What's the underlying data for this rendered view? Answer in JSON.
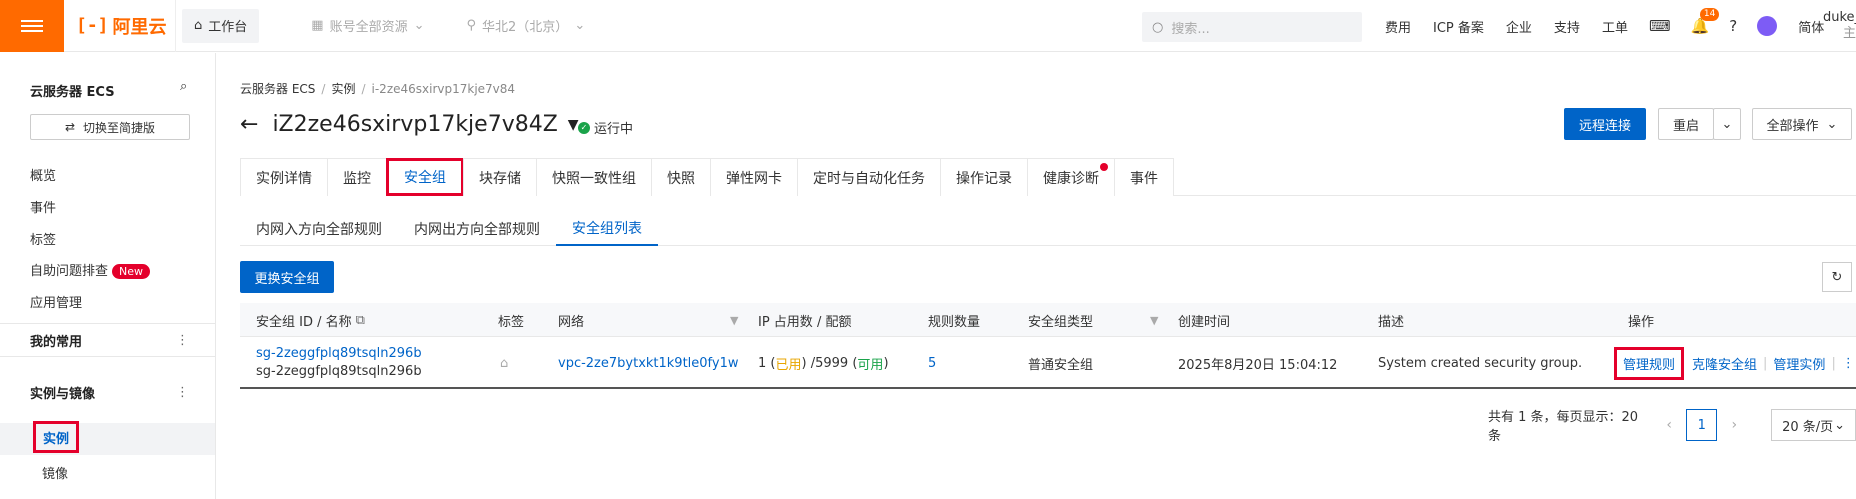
{
  "topbar": {
    "logo": "阿里云",
    "workbench": "工作台",
    "resources": "账号全部资源",
    "region": "华北2（北京）",
    "search_placeholder": "搜索...",
    "links": [
      "费用",
      "ICP 备案",
      "企业",
      "支持",
      "工单"
    ],
    "notification_count": "14",
    "language": "简体",
    "user_name": "duke_",
    "user_sub": "主"
  },
  "sidebar": {
    "title": "云服务器 ECS",
    "switch_label": "切换至简捷版",
    "items": [
      "概览",
      "事件",
      "标签",
      "自助问题排查",
      "应用管理"
    ],
    "new_badge": "New",
    "section_common": "我的常用",
    "section_instances": "实例与镜像",
    "more": "⋮",
    "sub_items": [
      "实例",
      "镜像"
    ]
  },
  "breadcrumb": {
    "items": [
      "云服务器 ECS",
      "实例"
    ],
    "current": "i-2ze46sxirvp17kje7v84",
    "sep": "/"
  },
  "header": {
    "title": "iZ2ze46sxirvp17kje7v84Z",
    "status": "运行中",
    "remote": "远程连接",
    "restart": "重启",
    "all_ops": "全部操作"
  },
  "tabs": [
    "实例详情",
    "监控",
    "安全组",
    "块存储",
    "快照一致性组",
    "快照",
    "弹性网卡",
    "定时与自动化任务",
    "操作记录",
    "健康诊断",
    "事件"
  ],
  "subtabs": [
    "内网入方向全部规则",
    "内网出方向全部规则",
    "安全组列表"
  ],
  "toolbar": {
    "change_sg": "更换安全组"
  },
  "table": {
    "headers": [
      "安全组 ID / 名称",
      "标签",
      "网络",
      "IP 占用数 / 配额",
      "规则数量",
      "安全组类型",
      "创建时间",
      "描述",
      "操作"
    ],
    "row": {
      "sg_id": "sg-2zeggfplq89tsqln296b",
      "sg_name": "sg-2zeggfplq89tsqln296b",
      "network": "vpc-2ze7bytxkt1k9tle0fy1w",
      "ip_used": "1",
      "used_label": "已用",
      "quota": "5999",
      "avail_label": "可用",
      "rules": "5",
      "sg_type": "普通安全组",
      "created": "2025年8月20日 15:04:12",
      "desc": "System created security group.",
      "actions": [
        "管理规则",
        "克隆安全组",
        "管理实例"
      ]
    }
  },
  "pager": {
    "summary": "共有 1 条，每页显示：20 条",
    "page": "1",
    "size": "20 条/页"
  }
}
